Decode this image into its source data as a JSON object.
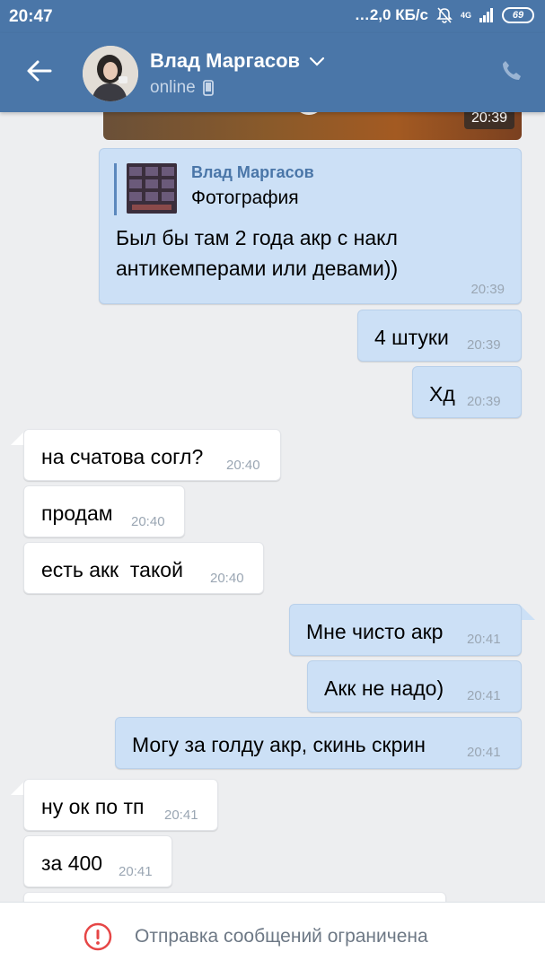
{
  "status_bar": {
    "time": "20:47",
    "network_speed": "…2,0 КБ/с",
    "network_gen": "4G",
    "battery": "69",
    "icons": [
      "mute-bell-icon",
      "signal-icon",
      "battery-icon"
    ]
  },
  "header": {
    "contact_name": "Влад Маргасов",
    "status": "online",
    "icons": [
      "back-arrow-icon",
      "chevron-down-icon",
      "mobile-icon",
      "phone-icon"
    ]
  },
  "colors": {
    "brand": "#4a76a8",
    "outgoing_bubble": "#cce0f6",
    "incoming_bubble": "#ffffff",
    "background": "#edeef0",
    "warning": "#e64646"
  },
  "messages": [
    {
      "type": "photo",
      "direction": "out",
      "time": "20:39"
    },
    {
      "type": "reply",
      "direction": "out",
      "reply_author": "Влад Маргасов",
      "reply_kind": "Фотография",
      "line1": "Был бы там 2 года акр с накл",
      "line2": "антикемперами или девами))",
      "time": "20:39"
    },
    {
      "direction": "out",
      "text": "4 штуки",
      "time": "20:39"
    },
    {
      "direction": "out",
      "text": "Хд",
      "time": "20:39"
    },
    {
      "direction": "in",
      "text": "на счатова согл?",
      "time": "20:40"
    },
    {
      "direction": "in",
      "text": "продам",
      "time": "20:40"
    },
    {
      "direction": "in",
      "text": "есть акк  такой",
      "time": "20:40"
    },
    {
      "direction": "out",
      "text": "Мне чисто акр",
      "time": "20:41"
    },
    {
      "direction": "out",
      "text": "Акк не надо)",
      "time": "20:41"
    },
    {
      "direction": "out",
      "text": "Могу за голду акр, скинь скрин",
      "time": "20:41"
    },
    {
      "direction": "in",
      "text": "ну ок по тп",
      "time": "20:41"
    },
    {
      "direction": "in",
      "text": "за 400",
      "time": "20:41"
    }
  ],
  "footer": {
    "notice": "Отправка сообщений ограничена",
    "icon": "warning-icon"
  }
}
